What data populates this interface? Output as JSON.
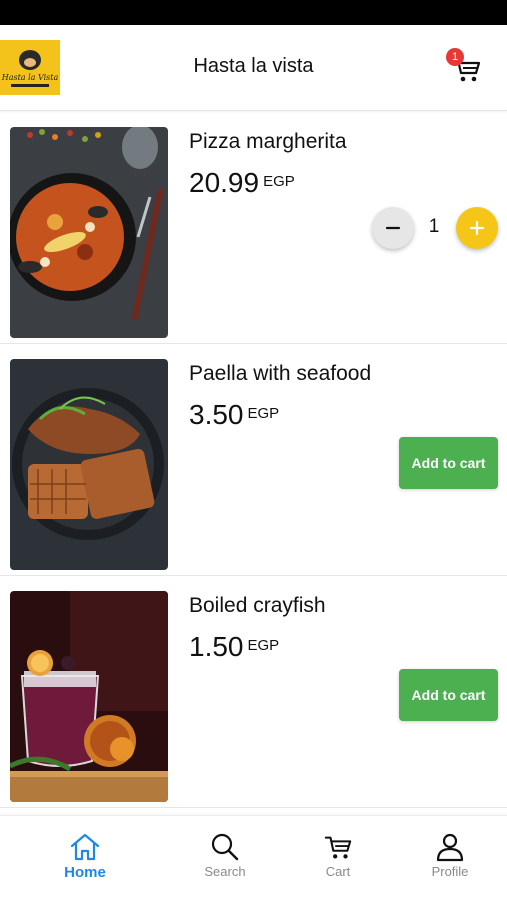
{
  "header": {
    "title": "Hasta la vista",
    "logo_text": "Hasta la Vista",
    "cart_count": "1",
    "colors": {
      "logo_bg": "#f3c21b",
      "badge": "#e53935"
    }
  },
  "items": [
    {
      "name": "Pizza margherita",
      "price": "20.99",
      "currency": "EGP",
      "in_cart": true,
      "quantity": "1",
      "image": "seafood-paella-photo"
    },
    {
      "name": "Paella with seafood",
      "price": "3.50",
      "currency": "EGP",
      "in_cart": false,
      "add_label": "Add to cart",
      "image": "fried-chicken-waffles-photo"
    },
    {
      "name": "Boiled crayfish",
      "price": "1.50",
      "currency": "EGP",
      "in_cart": false,
      "add_label": "Add to cart",
      "image": "berry-cocktail-photo"
    }
  ],
  "nav": {
    "items": [
      {
        "label": "Home",
        "icon": "home-icon",
        "active": true
      },
      {
        "label": "Search",
        "icon": "search-icon",
        "active": false
      },
      {
        "label": "Cart",
        "icon": "cart-icon",
        "active": false
      },
      {
        "label": "Profile",
        "icon": "profile-icon",
        "active": false
      }
    ]
  },
  "colors": {
    "accent": "#1e88e5",
    "add_button": "#4caf50",
    "plus_button": "#f5c518"
  }
}
